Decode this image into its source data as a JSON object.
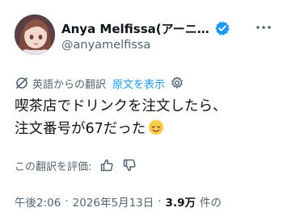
{
  "author": {
    "display_name": "Anya Melfissa(アーニ…",
    "handle": "@anyamelfissa"
  },
  "translation": {
    "label": "英語からの翻訳",
    "show_original": "原文を表示"
  },
  "post": {
    "line1": "喫茶店でドリンクを注文したら、",
    "line2": "注文番号が67だった"
  },
  "rating": {
    "label": "この翻訳を評価:"
  },
  "meta": {
    "time": "午後2:06",
    "separator": "·",
    "date": "2026年5月13日",
    "views": "3.9万",
    "views_label": "件の"
  },
  "colors": {
    "accent": "#1d9bf0",
    "text": "#0f1419",
    "muted": "#536471"
  },
  "icons": [
    "verified-badge-icon",
    "more-icon",
    "translate-icon",
    "gear-icon",
    "thumbs-up-icon",
    "thumbs-down-icon",
    "relieved-face-emoji"
  ]
}
